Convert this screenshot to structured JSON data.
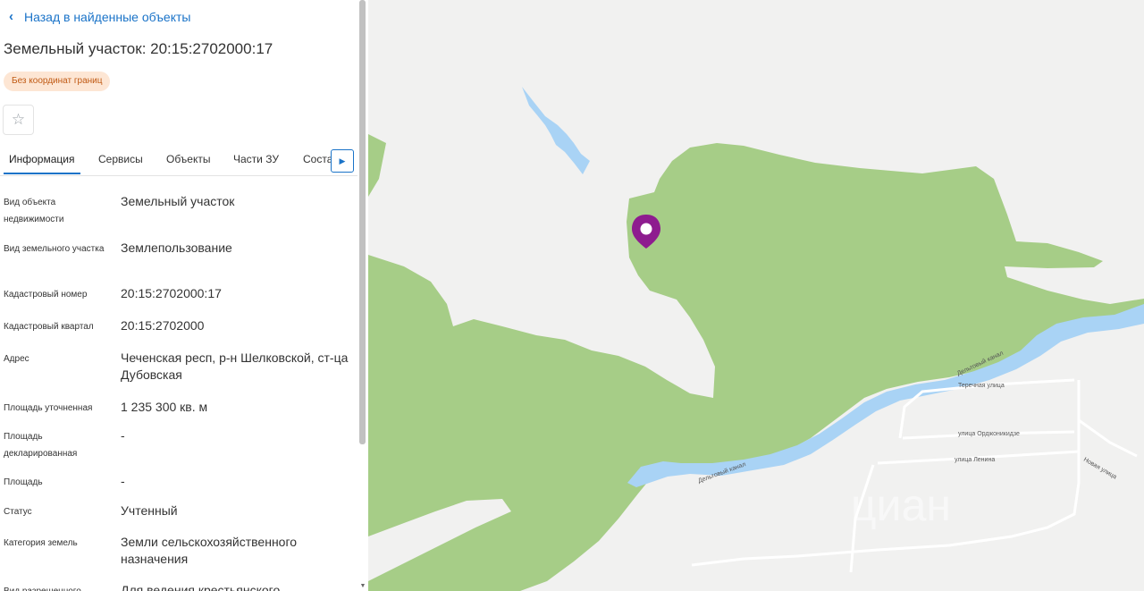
{
  "panel": {
    "back_label": "Назад в найденные объекты",
    "title": "Земельный участок: 20:15:2702000:17",
    "badge": "Без координат границ",
    "star_icon": "star-icon",
    "tabs": [
      {
        "label": "Информация",
        "active": true
      },
      {
        "label": "Сервисы"
      },
      {
        "label": "Объекты"
      },
      {
        "label": "Части ЗУ"
      },
      {
        "label": "Соста"
      }
    ],
    "fields": [
      {
        "label": "Вид объекта недвижимости",
        "value": "Земельный участок"
      },
      {
        "label": "Вид земельного участка",
        "value": "Землепользование"
      },
      {
        "label": "Кадастровый номер",
        "value": "20:15:2702000:17"
      },
      {
        "label": "Кадастровый квартал",
        "value": "20:15:2702000"
      },
      {
        "label": "Адрес",
        "value": "Чеченская респ, р-н Шелковской, ст-ца Дубовская"
      },
      {
        "label": "Площадь уточненная",
        "value": "1 235 300 кв. м"
      },
      {
        "label": "Площадь декларированная",
        "value": "-"
      },
      {
        "label": "Площадь",
        "value": "-"
      },
      {
        "label": "Статус",
        "value": "Учтенный"
      },
      {
        "label": "Категория земель",
        "value": "Земли сельскохозяйственного назначения"
      },
      {
        "label": "Вид разрешенного",
        "value": "Для ведения крестьянского"
      }
    ]
  },
  "map": {
    "streets": {
      "terechnaya": "Теречная улица",
      "ordzhonikidze": "улица Орджоникидзе",
      "lenina": "улица Ленина",
      "novaya": "Новая улица",
      "canal1": "Дельтовый канал",
      "canal2": "Дельтовый канал"
    },
    "watermark": "циан",
    "marker_icon": "location-pin-icon",
    "colors": {
      "land": "#f1f1f0",
      "forest": "#a6cd87",
      "water": "#a9d3f5",
      "marker": "#8e1c8f"
    }
  }
}
